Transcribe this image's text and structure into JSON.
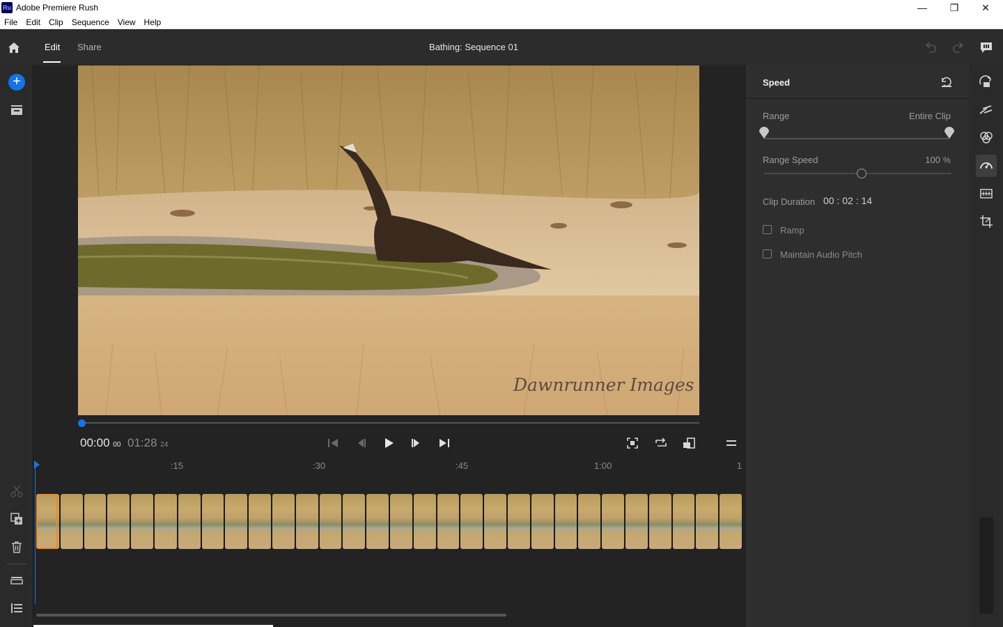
{
  "window": {
    "app_logo": "Ru",
    "title": "Adobe Premiere Rush",
    "controls": [
      "—",
      "❐",
      "✕"
    ]
  },
  "menu": [
    "File",
    "Edit",
    "Clip",
    "Sequence",
    "View",
    "Help"
  ],
  "header": {
    "tabs": [
      {
        "label": "Edit",
        "active": true
      },
      {
        "label": "Share",
        "active": false
      }
    ],
    "sequence_title": "Bathing: Sequence 01"
  },
  "monitor": {
    "watermark": "Dawnrunner Images",
    "current_time": "00:00",
    "current_frames": "00",
    "total_time": "01:28",
    "total_frames": "24",
    "playhead_fraction": 0.0
  },
  "timeline": {
    "ruler_labels": [
      ":15",
      ":30",
      ":45",
      "1:00",
      "1"
    ],
    "thumbnail_count": 30
  },
  "speed_panel": {
    "title": "Speed",
    "range_label": "Range",
    "range_value": "Entire Clip",
    "range_start_fraction": 0.0,
    "range_end_fraction": 1.0,
    "range_speed_label": "Range Speed",
    "range_speed_value": "100",
    "range_speed_unit": "%",
    "range_speed_fraction": 0.52,
    "clip_duration_label": "Clip Duration",
    "clip_duration": {
      "hh": "00",
      "mm": "02",
      "ss": "14"
    },
    "ramp_label": "Ramp",
    "ramp_checked": false,
    "maintain_pitch_label": "Maintain Audio Pitch",
    "maintain_pitch_checked": false
  },
  "colors": {
    "accent": "#1473e6",
    "clip_selected": "#f08a1c",
    "panel_bg": "#2e2e2e",
    "app_bg": "#232323"
  }
}
